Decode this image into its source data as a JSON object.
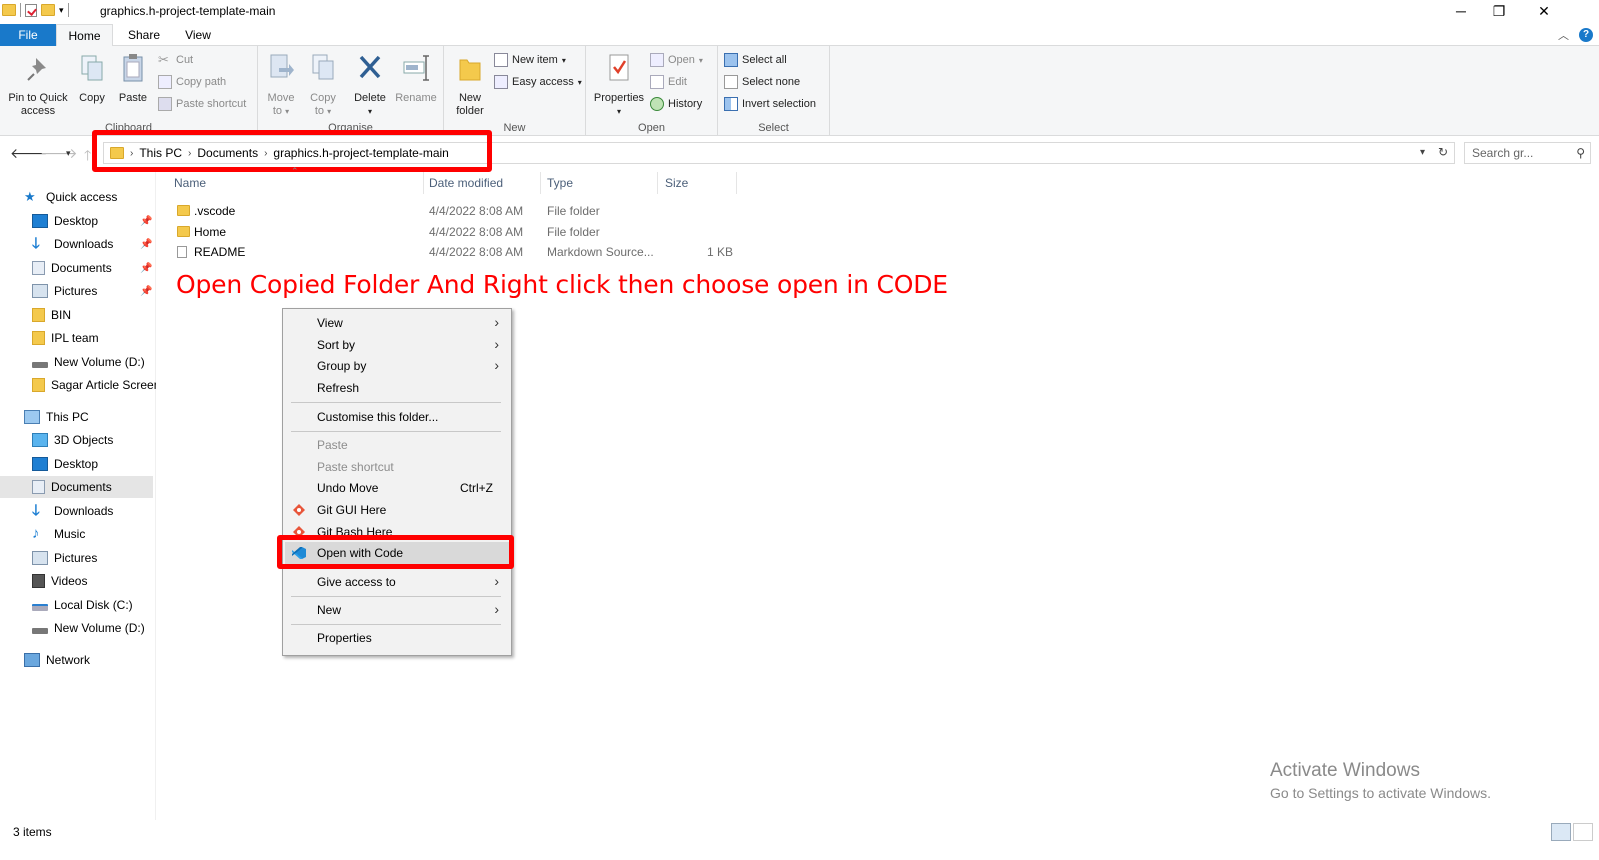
{
  "window": {
    "title": "graphics.h-project-template-main",
    "minimize": "─",
    "maximize": "❐",
    "close": "✕"
  },
  "ribbon_tabs": [
    "File",
    "Home",
    "Share",
    "View"
  ],
  "ribbon": {
    "clipboard": {
      "label": "Clipboard",
      "pin_label_1": "Pin to Quick",
      "pin_label_2": "access",
      "copy": "Copy",
      "paste": "Paste",
      "cut": "Cut",
      "copy_path": "Copy path",
      "paste_shortcut": "Paste shortcut"
    },
    "organise": {
      "label": "Organise",
      "move_1": "Move",
      "move_2": "to",
      "copy_1": "Copy",
      "copy_2": "to",
      "delete": "Delete",
      "rename": "Rename"
    },
    "new": {
      "label": "New",
      "new_folder_1": "New",
      "new_folder_2": "folder",
      "new_item": "New item",
      "easy_access": "Easy access"
    },
    "open": {
      "label": "Open",
      "properties": "Properties",
      "open": "Open",
      "edit": "Edit",
      "history": "History"
    },
    "select": {
      "label": "Select",
      "select_all": "Select all",
      "select_none": "Select none",
      "invert_selection": "Invert selection"
    }
  },
  "address": {
    "crumbs": [
      "This PC",
      "Documents",
      "graphics.h-project-template-main"
    ],
    "search_placeholder": "Search gr..."
  },
  "nav_pane": {
    "quick_access": "Quick access",
    "quick_items": [
      "Desktop",
      "Downloads",
      "Documents",
      "Pictures",
      "BIN",
      "IPL team",
      "New Volume (D:)",
      "Sagar Article Screen"
    ],
    "this_pc": "This PC",
    "pc_items": [
      "3D Objects",
      "Desktop",
      "Documents",
      "Downloads",
      "Music",
      "Pictures",
      "Videos",
      "Local Disk (C:)",
      "New Volume (D:)"
    ],
    "network": "Network"
  },
  "columns": [
    "Name",
    "Date modified",
    "Type",
    "Size"
  ],
  "files": [
    {
      "name": ".vscode",
      "date": "4/4/2022 8:08 AM",
      "type": "File folder",
      "size": ""
    },
    {
      "name": "Home",
      "date": "4/4/2022 8:08 AM",
      "type": "File folder",
      "size": ""
    },
    {
      "name": "README",
      "date": "4/4/2022 8:08 AM",
      "type": "Markdown Source...",
      "size": "1 KB"
    }
  ],
  "instruction": "Open Copied Folder And Right click then choose open in CODE",
  "context_menu": {
    "view": "View",
    "sort_by": "Sort by",
    "group_by": "Group by",
    "refresh": "Refresh",
    "customise": "Customise this folder...",
    "paste": "Paste",
    "paste_shortcut": "Paste shortcut",
    "undo_move": "Undo Move",
    "undo_shortcut": "Ctrl+Z",
    "git_gui": "Git GUI Here",
    "git_bash": "Git Bash Here",
    "open_with_code": "Open with Code",
    "give_access": "Give access to",
    "new": "New",
    "properties": "Properties"
  },
  "status": {
    "items": "3 items"
  },
  "watermark": {
    "line1": "Activate Windows",
    "line2": "Go to Settings to activate Windows."
  },
  "colors": {
    "accent": "#1979ca",
    "highlight": "#ff0000",
    "folder": "#f4c94c"
  }
}
